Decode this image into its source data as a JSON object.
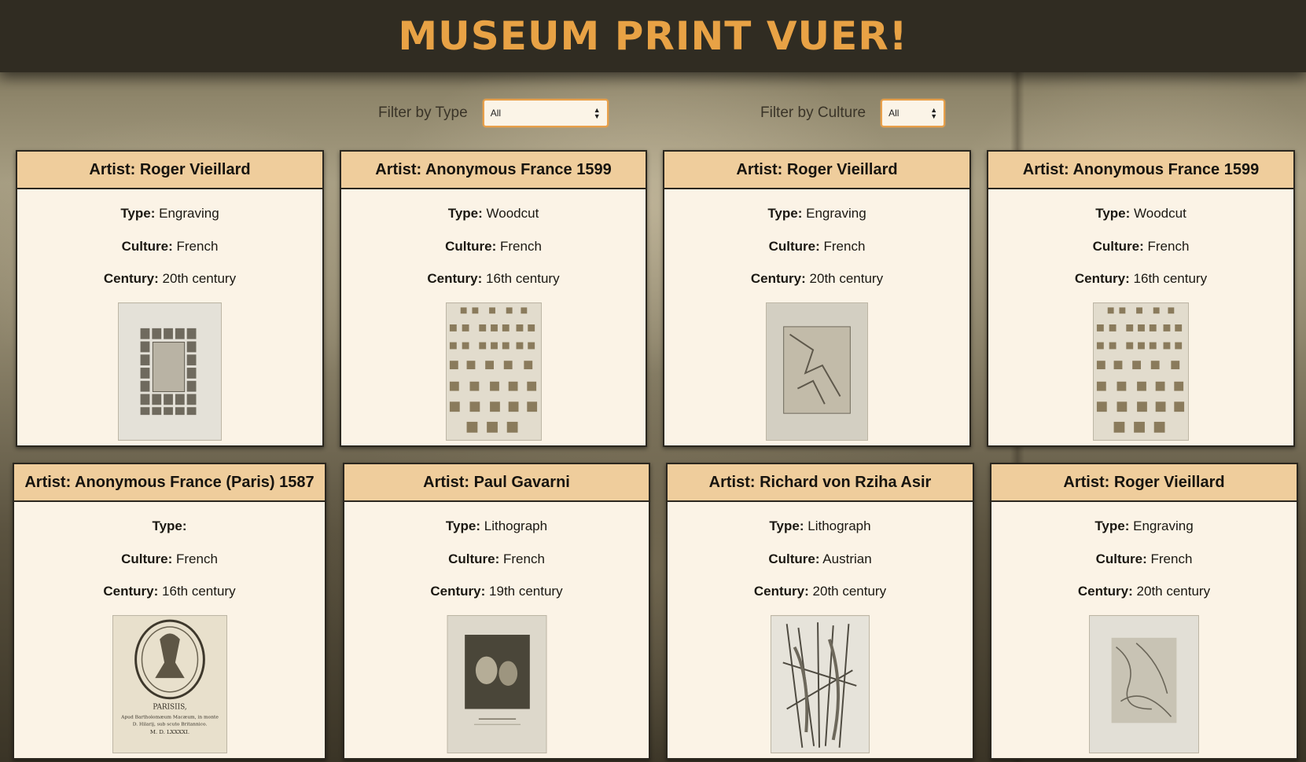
{
  "header": {
    "title": "MUSEUM PRINT VUER!"
  },
  "filters": {
    "type": {
      "label": "Filter by Type",
      "value": "All"
    },
    "culture": {
      "label": "Filter by Culture",
      "value": "All"
    }
  },
  "labels": {
    "type": "Type:",
    "culture": "Culture:",
    "century": "Century:"
  },
  "cards": [
    {
      "artist": "Artist: Roger Vieillard",
      "type": "Engraving",
      "culture": "French",
      "century": "20th century",
      "thumb": "engraving-grid-icon"
    },
    {
      "artist": "Artist: Anonymous France 1599",
      "type": "Woodcut",
      "culture": "French",
      "century": "16th century",
      "thumb": "woodcut-letters-icon"
    },
    {
      "artist": "Artist: Roger Vieillard",
      "type": "Engraving",
      "culture": "French",
      "century": "20th century",
      "thumb": "framed-engraving-icon"
    },
    {
      "artist": "Artist: Anonymous France 1599",
      "type": "Woodcut",
      "culture": "French",
      "century": "16th century",
      "thumb": "woodcut-letters-icon"
    },
    {
      "artist": "Artist: Anonymous France (Paris) 1587",
      "type": "",
      "culture": "French",
      "century": "16th century",
      "thumb": "title-page-icon"
    },
    {
      "artist": "Artist: Paul Gavarni",
      "type": "Lithograph",
      "culture": "French",
      "century": "19th century",
      "thumb": "lithograph-portrait-icon"
    },
    {
      "artist": "Artist: Richard von Rziha Asir",
      "type": "Lithograph",
      "culture": "Austrian",
      "century": "20th century",
      "thumb": "lithograph-forest-icon"
    },
    {
      "artist": "Artist: Roger Vieillard",
      "type": "Engraving",
      "culture": "French",
      "century": "20th century",
      "thumb": "abstract-engraving-icon"
    }
  ],
  "title_page_text": {
    "line1": "PARISIIS,",
    "line2": "Apud Bartholomæum Macæum, in monte",
    "line3": "D. Hilarij, sub scuto Britannico.",
    "line4": "M. D. LXXXXI."
  }
}
